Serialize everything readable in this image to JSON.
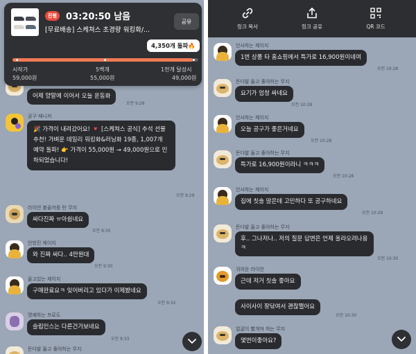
{
  "deal": {
    "status_badge": "진행",
    "countdown": "03:20:50 남음",
    "product_title": "[무료배송] 스케쳐스 초경량 워킹화/...",
    "share_label": "공유",
    "participants_tooltip": "4,350개 돌파🔥",
    "progress_fraction": 0.97,
    "milestones": [
      {
        "label": "시작가",
        "price": "59,000원"
      },
      {
        "label": "5백개",
        "price": "55,000원"
      },
      {
        "label": "1천개 달성시",
        "price": "49,000원"
      }
    ],
    "accent_color": "#f07a55"
  },
  "left_chat": {
    "messages": [
      {
        "sender": "",
        "text": "어제 양말에 이어서 오늘 운동화",
        "time": "오전 9:28"
      },
      {
        "sender": "공구 매니저",
        "text": "🎉 가격이 내려갔어요! 🔻 [스케쳐스 공식] 추석 선물 추천! 가벼운 데일리 워킹화&러닝화 19종, 1,007개 예약 돌파! 👉 가격이 55,000원 → 49,000원으로 인하되었습니다!",
        "time": "오전 9:29"
      },
      {
        "sender": "라이언 볼꼴까를 탄 무지",
        "text": "싸다진짜 ㅠ아쉽네요",
        "time": "오전 9:30"
      },
      {
        "sender": "안방진 제이지",
        "text": "와 진짜 싸다.. 4만원대",
        "time": "오전 9:30"
      },
      {
        "sender": "울고있는 제이지",
        "text": "구매완료요ㅋ 잊어버리고 있다가 이제봤네요",
        "time": "오전 9:32"
      },
      {
        "sender": "명예하는 프로도",
        "text": "슬립인스는 다른건가보네요",
        "time": "오전 9:33"
      },
      {
        "sender": "돈다발 들고 좋아하는 무지",
        "text": "",
        "time": ""
      }
    ]
  },
  "toolbar": {
    "items": [
      {
        "icon": "link-icon",
        "label": "링크 복사"
      },
      {
        "icon": "share-icon",
        "label": "링크 공유"
      },
      {
        "icon": "qr-code-icon",
        "label": "QR 코드"
      }
    ]
  },
  "right_chat": {
    "messages": [
      {
        "sender": "인사하는 제이지",
        "text": "1번 상품 타 홈쇼핑에서 특가로 16,900원이네여",
        "time": "오전 10:28"
      },
      {
        "sender": "돈다발 들고 좋아하는 무지",
        "text": "요기가 엄청 싸네요",
        "time": "오전 10:28"
      },
      {
        "sender": "인사하는 제이지",
        "text": "오늘 공구가 좋은거네요",
        "time": "오전 10:28"
      },
      {
        "sender": "돈다발 들고 좋아하는 무지",
        "text": "특가로 16,900원이라니 ㅋㅋㅋ",
        "time": "오전 10:28"
      },
      {
        "sender": "인사하는 제이지",
        "text": "집에 칫솔 많은데 고민하다 또 공구하네요",
        "time": "오전 10:29"
      },
      {
        "sender": "돈다발 들고 좋아하는 무지",
        "text": "후.. 그나저나.. 저의 질문 답변은 언제 올라오려나용 ㅋ",
        "time": "오전 10:30"
      },
      {
        "sender": "귀여운 라이언",
        "text": "근데 저거 칫솔 좋아요",
        "time": ""
      },
      {
        "sender": "",
        "text": "사이사이 잘닦여서 괜찮쩔어요",
        "time": "오전 10:30"
      },
      {
        "sender": "얼굴이 빨개져 하는 무지",
        "text": "몇번이좋아요?",
        "time": ""
      }
    ]
  }
}
